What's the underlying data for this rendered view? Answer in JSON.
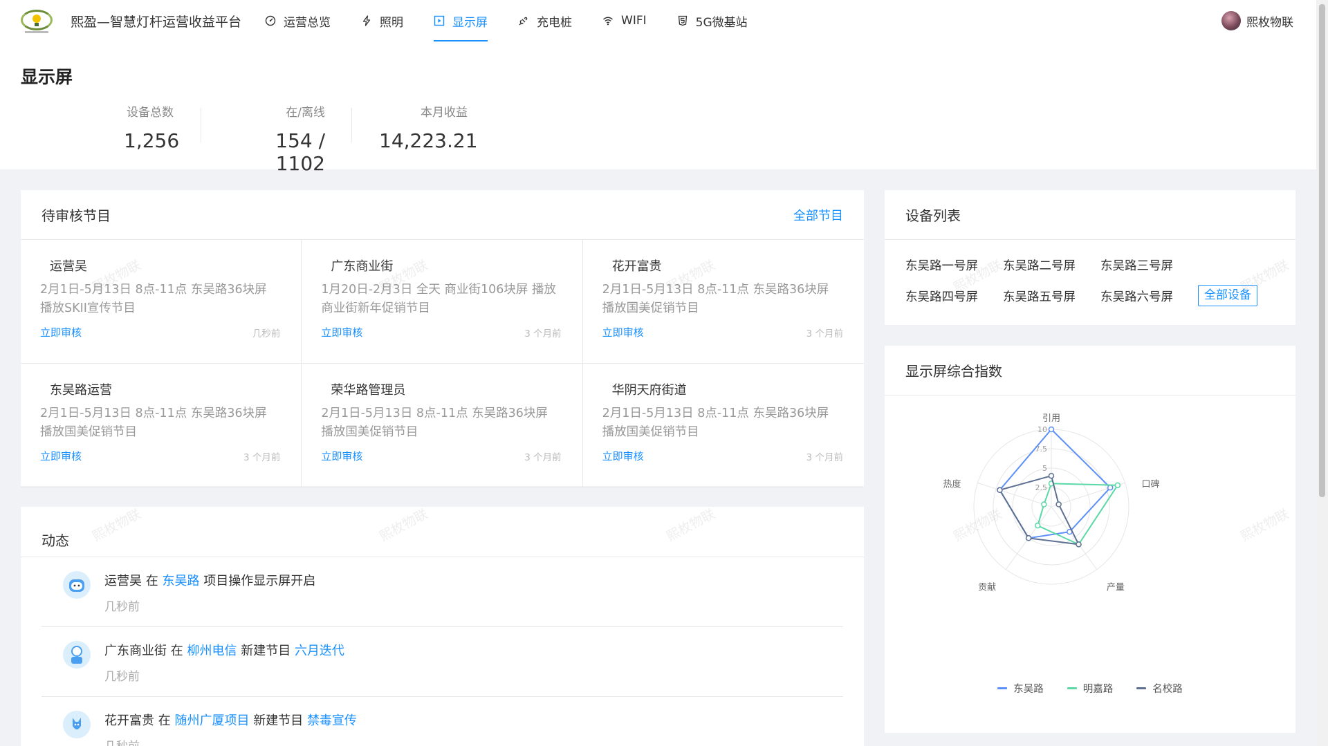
{
  "app": {
    "title": "熙盈—智慧灯杆运营收益平台",
    "user_name": "熙枚物联"
  },
  "nav": {
    "items": [
      {
        "label": "运营总览",
        "icon": "dashboard-icon",
        "active": false
      },
      {
        "label": "照明",
        "icon": "lightning-icon",
        "active": false
      },
      {
        "label": "显示屏",
        "icon": "play-square-icon",
        "active": true
      },
      {
        "label": "充电桩",
        "icon": "plug-icon",
        "active": false
      },
      {
        "label": "WIFI",
        "icon": "wifi-icon",
        "active": false
      },
      {
        "label": "5G微基站",
        "icon": "html5-icon",
        "active": false
      }
    ]
  },
  "header": {
    "title": "显示屏",
    "stats": [
      {
        "label": "设备总数",
        "value": "1,256"
      },
      {
        "label": "在/离线",
        "value": "154 / 1102"
      },
      {
        "label": "本月收益",
        "value": "14,223.21"
      }
    ]
  },
  "pending": {
    "title": "待审核节目",
    "all_link": "全部节目",
    "action_label": "立即审核",
    "items": [
      {
        "who": "运营吴",
        "desc": "2月1日-5月13日 8点-11点 东吴路36块屏 播放SKII宣传节目",
        "time": "几秒前"
      },
      {
        "who": "广东商业街",
        "desc": "1月20日-2月3日 全天 商业街106块屏 播放商业街新年促销节目",
        "time": "3 个月前"
      },
      {
        "who": "花开富贵",
        "desc": "2月1日-5月13日 8点-11点 东吴路36块屏 播放国美促销节目",
        "time": "3 个月前"
      },
      {
        "who": "东吴路运营",
        "desc": "2月1日-5月13日 8点-11点 东吴路36块屏 播放国美促销节目",
        "time": "3 个月前"
      },
      {
        "who": "荣华路管理员",
        "desc": "2月1日-5月13日 8点-11点 东吴路36块屏 播放国美促销节目",
        "time": "3 个月前"
      },
      {
        "who": "华阴天府街道",
        "desc": "2月1日-5月13日 8点-11点 东吴路36块屏 播放国美促销节目",
        "time": "3 个月前"
      }
    ]
  },
  "devices": {
    "title": "设备列表",
    "items": [
      "东吴路一号屏",
      "东吴路二号屏",
      "东吴路三号屏",
      "东吴路四号屏",
      "东吴路五号屏",
      "东吴路六号屏"
    ],
    "all_label": "全部设备"
  },
  "activity": {
    "title": "动态",
    "items": [
      {
        "user": "运营吴",
        "w1": "在",
        "target": "东吴路",
        "w2": "项目操作显示屏开启",
        "extra": "",
        "ago": "几秒前"
      },
      {
        "user": "广东商业街",
        "w1": "在",
        "target": "柳州电信",
        "w2": "新建节目",
        "extra": "六月迭代",
        "ago": "几秒前"
      },
      {
        "user": "花开富贵",
        "w1": "在",
        "target": "随州广厦项目",
        "w2": "新建节目",
        "extra": "禁毒宣传",
        "ago": "几秒前"
      }
    ]
  },
  "watermark": "熙枚物联",
  "radar": {
    "title": "显示屏综合指数"
  },
  "chart_data": {
    "type": "radar",
    "indicators": [
      "引用",
      "口碑",
      "产量",
      "贡献",
      "热度"
    ],
    "max": 10,
    "ticks": [
      "2.5",
      "5",
      "7.5",
      "10"
    ],
    "series": [
      {
        "name": "东吴路",
        "values": [
          10,
          8,
          4,
          5,
          7
        ],
        "color": "#5b8ff9"
      },
      {
        "name": "明嘉路",
        "values": [
          3,
          9,
          6,
          3,
          1
        ],
        "color": "#5ad8a6"
      },
      {
        "name": "名校路",
        "values": [
          4,
          1,
          6,
          5,
          7
        ],
        "color": "#5d7092"
      }
    ],
    "legend_position": "bottom"
  }
}
